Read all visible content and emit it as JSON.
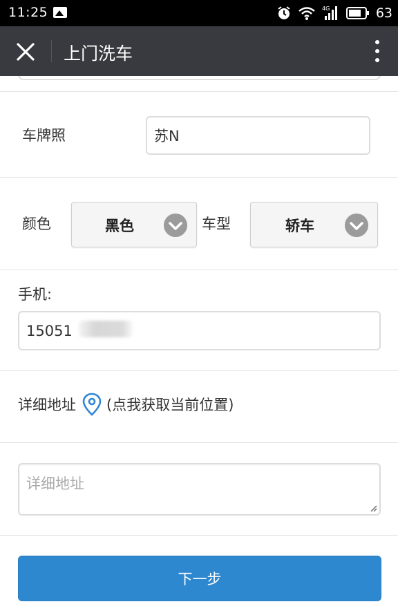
{
  "status_bar": {
    "time": "11:25",
    "battery": "63",
    "icons": [
      "image-icon",
      "alarm-icon",
      "wifi-icon",
      "signal-4g-icon",
      "battery-icon"
    ]
  },
  "title_bar": {
    "title": "上门洗车",
    "close_icon": "close-icon",
    "more_icon": "more-vertical-icon"
  },
  "form": {
    "plate_label": "车牌照",
    "plate_value": "苏N",
    "color_label": "颜色",
    "color_value": "黑色",
    "type_label": "车型",
    "type_value": "轿车",
    "phone_label": "手机:",
    "phone_value": "15051",
    "phone_suffix_visible": "",
    "address_label": "详细地址",
    "locate_hint": "(点我获取当前位置)",
    "address_placeholder": "详细地址",
    "next_button": "下一步"
  },
  "colors": {
    "title_bar_bg": "#393a3f",
    "button_blue": "#2e88d0",
    "location_icon_blue": "#2f86d6"
  }
}
